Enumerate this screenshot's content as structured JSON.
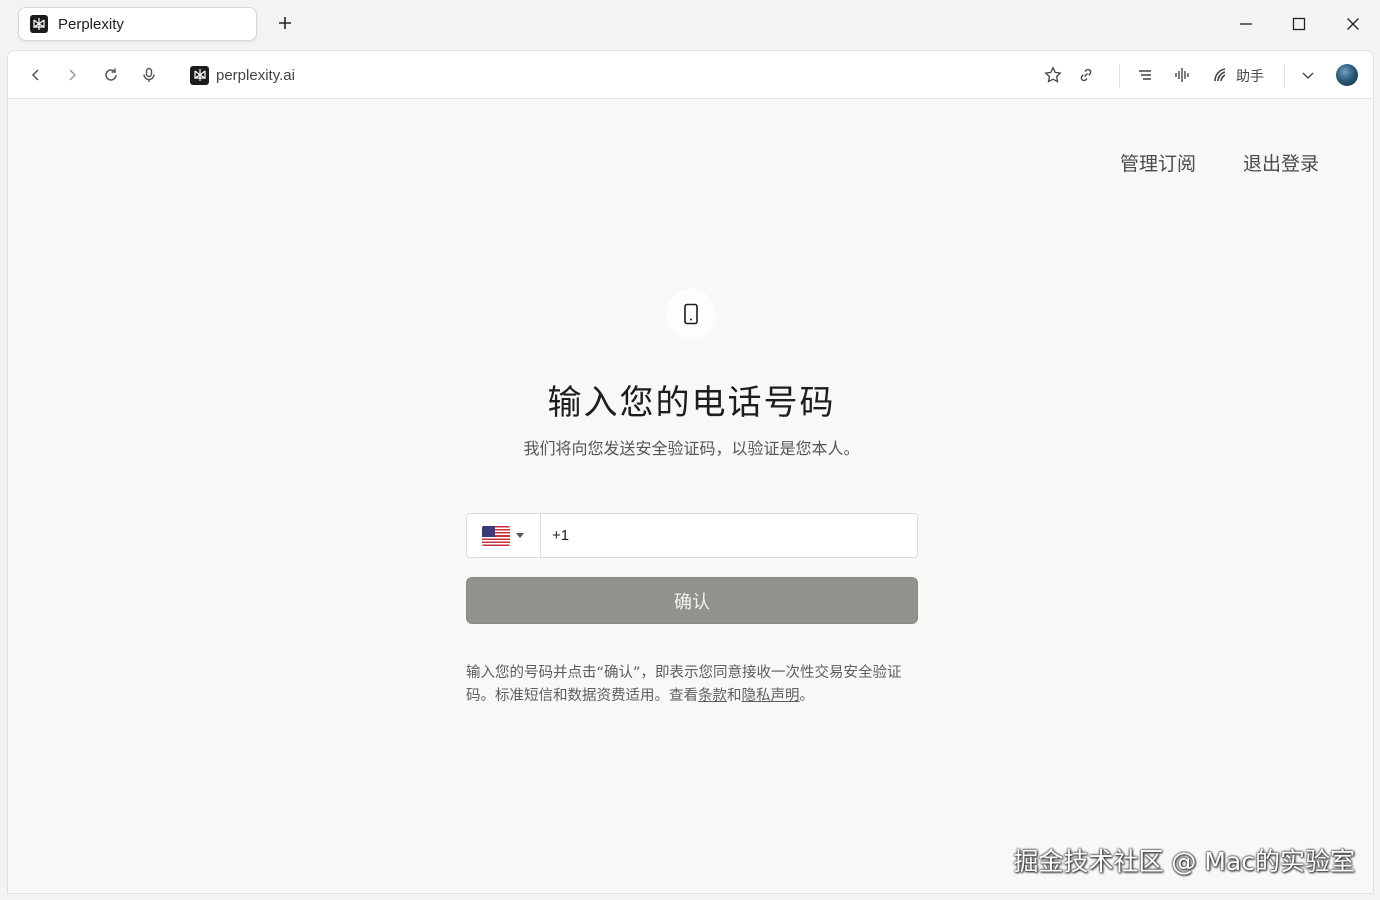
{
  "browser": {
    "tab_title": "Perplexity",
    "address": "perplexity.ai",
    "assistant_label": "助手"
  },
  "page": {
    "nav": {
      "manage_subscription": "管理订阅",
      "logout": "退出登录"
    },
    "heading": "输入您的电话号码",
    "subheading": "我们将向您发送安全验证码，以验证是您本人。",
    "phone": {
      "country": "United States",
      "value": "+1"
    },
    "confirm_label": "确认",
    "disclaimer": {
      "text": "输入您的号码并点击“确认”，即表示您同意接收一次性交易安全验证码。标准短信和数据资费适用。查看",
      "terms_link": "条款",
      "and": "和",
      "privacy_link": "隐私声明",
      "end": "。"
    }
  },
  "watermark": "掘金技术社区 @ Mac的实验室",
  "colors": {
    "page_bg": "#f9f8f6",
    "button_bg": "#93918c"
  }
}
